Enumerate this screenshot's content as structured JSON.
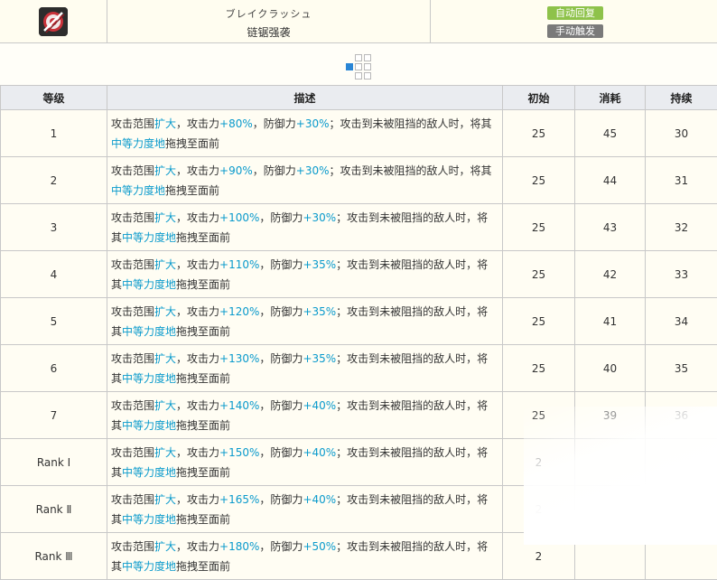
{
  "header": {
    "name_jp": "ブレイクラッシュ",
    "name_cn": "链锯强袭",
    "tag_auto": "自动回复",
    "tag_manual": "手动触发"
  },
  "table": {
    "columns": [
      "等级",
      "描述",
      "初始",
      "消耗",
      "持续"
    ],
    "rows": [
      {
        "level": "1",
        "d1": "攻击范围",
        "d2": "扩大",
        "d3": "，攻击力",
        "d4": "+80%",
        "d5": "，防御力",
        "d6": "+30%",
        "d7": "；攻击到未被阻挡的敌人时，将其",
        "d8": "中等力度地",
        "d9": "拖拽至面前",
        "initial": "25",
        "cost": "45",
        "duration": "30"
      },
      {
        "level": "2",
        "d1": "攻击范围",
        "d2": "扩大",
        "d3": "，攻击力",
        "d4": "+90%",
        "d5": "，防御力",
        "d6": "+30%",
        "d7": "；攻击到未被阻挡的敌人时，将其",
        "d8": "中等力度地",
        "d9": "拖拽至面前",
        "initial": "25",
        "cost": "44",
        "duration": "31"
      },
      {
        "level": "3",
        "d1": "攻击范围",
        "d2": "扩大",
        "d3": "，攻击力",
        "d4": "+100%",
        "d5": "，防御力",
        "d6": "+30%",
        "d7": "；攻击到未被阻挡的敌人时，将其",
        "d8": "中等力度地",
        "d9": "拖拽至面前",
        "initial": "25",
        "cost": "43",
        "duration": "32"
      },
      {
        "level": "4",
        "d1": "攻击范围",
        "d2": "扩大",
        "d3": "，攻击力",
        "d4": "+110%",
        "d5": "，防御力",
        "d6": "+35%",
        "d7": "；攻击到未被阻挡的敌人时，将其",
        "d8": "中等力度地",
        "d9": "拖拽至面前",
        "initial": "25",
        "cost": "42",
        "duration": "33"
      },
      {
        "level": "5",
        "d1": "攻击范围",
        "d2": "扩大",
        "d3": "，攻击力",
        "d4": "+120%",
        "d5": "，防御力",
        "d6": "+35%",
        "d7": "；攻击到未被阻挡的敌人时，将其",
        "d8": "中等力度地",
        "d9": "拖拽至面前",
        "initial": "25",
        "cost": "41",
        "duration": "34"
      },
      {
        "level": "6",
        "d1": "攻击范围",
        "d2": "扩大",
        "d3": "，攻击力",
        "d4": "+130%",
        "d5": "，防御力",
        "d6": "+35%",
        "d7": "；攻击到未被阻挡的敌人时，将其",
        "d8": "中等力度地",
        "d9": "拖拽至面前",
        "initial": "25",
        "cost": "40",
        "duration": "35"
      },
      {
        "level": "7",
        "d1": "攻击范围",
        "d2": "扩大",
        "d3": "，攻击力",
        "d4": "+140%",
        "d5": "，防御力",
        "d6": "+40%",
        "d7": "；攻击到未被阻挡的敌人时，将其",
        "d8": "中等力度地",
        "d9": "拖拽至面前",
        "initial": "25",
        "cost": "39",
        "duration": "36"
      },
      {
        "level": "Rank Ⅰ",
        "d1": "攻击范围",
        "d2": "扩大",
        "d3": "，攻击力",
        "d4": "+150%",
        "d5": "，防御力",
        "d6": "+40%",
        "d7": "；攻击到未被阻挡的敌人时，将其",
        "d8": "中等力度地",
        "d9": "拖拽至面前",
        "initial": "2",
        "cost": "",
        "duration": ""
      },
      {
        "level": "Rank Ⅱ",
        "d1": "攻击范围",
        "d2": "扩大",
        "d3": "，攻击力",
        "d4": "+165%",
        "d5": "，防御力",
        "d6": "+40%",
        "d7": "；攻击到未被阻挡的敌人时，将其",
        "d8": "中等力度地",
        "d9": "拖拽至面前",
        "initial": "2",
        "cost": "",
        "duration": ""
      },
      {
        "level": "Rank Ⅲ",
        "d1": "攻击范围",
        "d2": "扩大",
        "d3": "，攻击力",
        "d4": "+180%",
        "d5": "，防御力",
        "d6": "+50%",
        "d7": "；攻击到未被阻挡的敌人时，将其",
        "d8": "中等力度地",
        "d9": "拖拽至面前",
        "initial": "2",
        "cost": "",
        "duration": ""
      }
    ]
  },
  "colors": {
    "highlight": "#0a9acc",
    "pager_active": "#2a86d6",
    "tag_auto": "#8ec24a",
    "tag_manual": "#7a7a7a"
  },
  "icons": {
    "skill": "chainsaw-skill-icon"
  }
}
